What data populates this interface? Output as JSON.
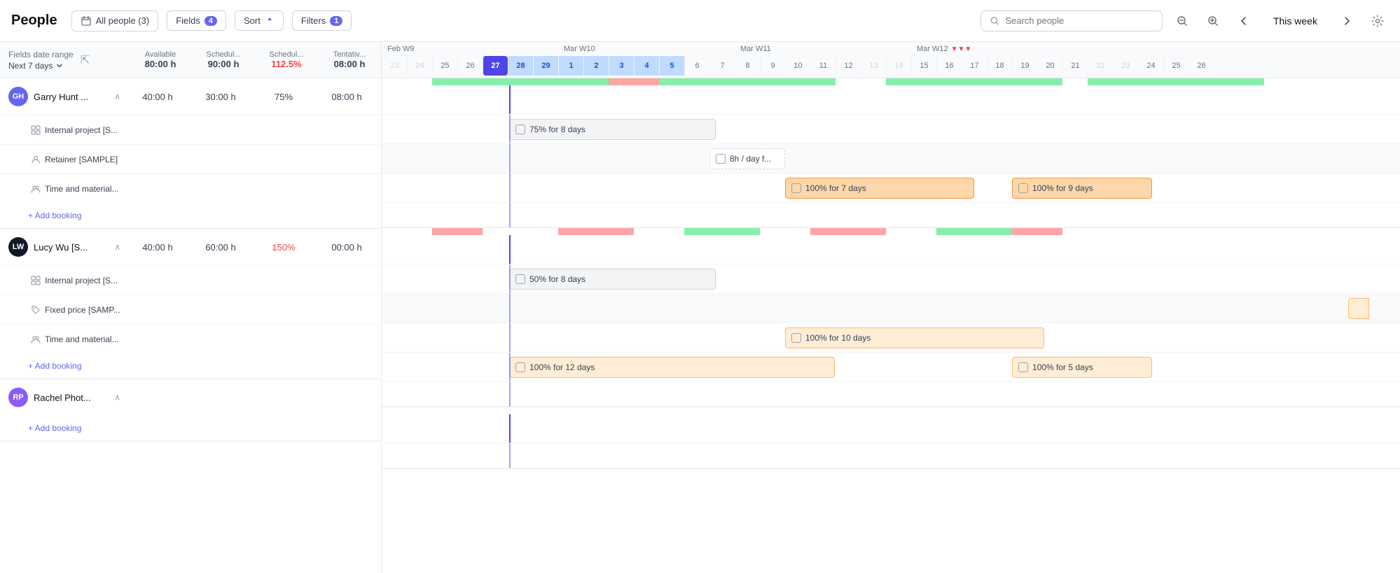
{
  "header": {
    "title": "People",
    "all_people_btn": "All people (3)",
    "fields_btn": "Fields",
    "fields_badge": "4",
    "sort_btn": "Sort",
    "filters_btn": "Filters",
    "filters_badge": "1",
    "search_placeholder": "Search people",
    "this_week_btn": "This week"
  },
  "columns": {
    "date_range_label": "Fields date range",
    "date_range_value": "Next 7 days",
    "available": "Available",
    "scheduled": "Schedul...",
    "scheduled2": "Schedul...",
    "tentative": "Tentativ..."
  },
  "column_values": {
    "available_val": "80:00 h",
    "scheduled_val": "90:00 h",
    "scheduled2_val": "112.5%",
    "tentative_val": "08:00 h"
  },
  "people": [
    {
      "name": "Garry Hunt ...",
      "avatar_initials": "GH",
      "avatar_color": "#6366f1",
      "available": "40:00 h",
      "scheduled": "30:00 h",
      "scheduled_pct": "75%",
      "tentative": "08:00 h",
      "projects": [
        {
          "name": "Internal project [S...",
          "icon": "grid"
        },
        {
          "name": "Retainer [SAMPLE]",
          "icon": "user"
        },
        {
          "name": "Time and material...",
          "icon": "people"
        }
      ],
      "bookings": [
        {
          "label": "75% for 8 days",
          "type": "solid-gray",
          "left_pct": 17,
          "width_pct": 28,
          "row": 0
        },
        {
          "label": "8h / day f...",
          "type": "dashed-gray",
          "left_pct": 46,
          "width_pct": 10,
          "row": 1
        },
        {
          "label": "100% for 7 days",
          "type": "solid-orange",
          "left_pct": 57,
          "width_pct": 23,
          "row": 2
        },
        {
          "label": "100% for 9 days",
          "type": "solid-orange",
          "left_pct": 89,
          "width_pct": 11,
          "row": 2
        }
      ]
    },
    {
      "name": "Lucy Wu [S...",
      "avatar_initials": "LW",
      "avatar_color": "#111827",
      "available": "40:00 h",
      "scheduled": "60:00 h",
      "scheduled_pct": "150%",
      "tentative": "00:00 h",
      "overloaded": true,
      "projects": [
        {
          "name": "Internal project [S...",
          "icon": "grid"
        },
        {
          "name": "Fixed price [SAMP...",
          "icon": "tag"
        },
        {
          "name": "Time and material...",
          "icon": "people"
        }
      ],
      "bookings": [
        {
          "label": "50% for 8 days",
          "type": "solid-gray",
          "left_pct": 17,
          "width_pct": 28,
          "row": 0
        },
        {
          "label": "100% for 10 days",
          "type": "solid-orange-light",
          "left_pct": 57,
          "width_pct": 30,
          "row": 1
        },
        {
          "label": "100% for 12 days",
          "type": "solid-orange-light",
          "left_pct": 17,
          "width_pct": 47,
          "row": 2
        },
        {
          "label": "100% for 5 days",
          "type": "solid-orange-light",
          "left_pct": 89,
          "width_pct": 11,
          "row": 2
        }
      ]
    },
    {
      "name": "Rachel Phot...",
      "avatar_initials": "RP",
      "avatar_color": "#8b5cf6",
      "available": "",
      "scheduled": "",
      "scheduled_pct": "",
      "tentative": "",
      "projects": []
    }
  ],
  "weeks": [
    {
      "label": "Feb W9",
      "days": [
        "23",
        "24",
        "25",
        "26",
        "27",
        "28",
        "29"
      ]
    },
    {
      "label": "Mar W10",
      "days": [
        "1",
        "2",
        "3",
        "4",
        "5",
        "6",
        "7"
      ]
    },
    {
      "label": "Mar W11",
      "days": [
        "8",
        "9",
        "10",
        "11",
        "12",
        "13",
        "14"
      ]
    },
    {
      "label": "Mar W12",
      "days": [
        "15",
        "16",
        "17",
        "18",
        "19",
        "20",
        "21"
      ]
    },
    {
      "label": "",
      "days": [
        "22",
        "23",
        "24"
      ]
    }
  ],
  "today_day": "27",
  "add_booking": "+ Add booking"
}
